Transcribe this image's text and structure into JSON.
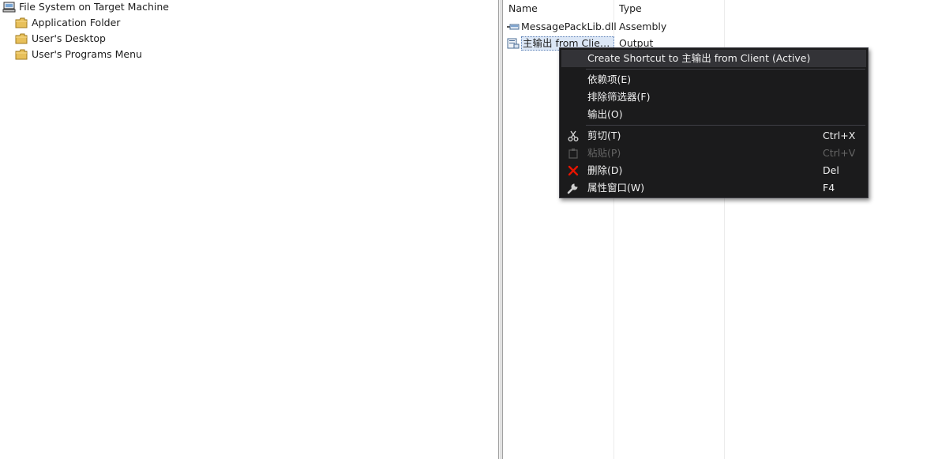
{
  "tree": {
    "root": {
      "label": "File System on Target Machine",
      "icon": "computer-icon"
    },
    "children": [
      {
        "label": "Application Folder",
        "icon": "folder-icon"
      },
      {
        "label": "User's Desktop",
        "icon": "folder-icon"
      },
      {
        "label": "User's Programs Menu",
        "icon": "folder-icon"
      }
    ]
  },
  "list": {
    "columns": {
      "name": "Name",
      "type": "Type"
    },
    "rows": [
      {
        "name": "MessagePackLib.dll",
        "type": "Assembly",
        "icon": "assembly-icon",
        "selected": false
      },
      {
        "name": "主输出 from Client...",
        "type": "Output",
        "icon": "project-output-icon",
        "selected": true
      }
    ]
  },
  "context_menu": {
    "items": [
      {
        "label": "Create Shortcut to 主输出 from Client (Active)",
        "shortcut": "",
        "icon": "",
        "enabled": true,
        "highlighted": true
      },
      {
        "label": "依赖项(E)",
        "shortcut": "",
        "icon": "",
        "enabled": true
      },
      {
        "label": "排除筛选器(F)",
        "shortcut": "",
        "icon": "",
        "enabled": true
      },
      {
        "label": "输出(O)",
        "shortcut": "",
        "icon": "",
        "enabled": true
      },
      {
        "label": "剪切(T)",
        "shortcut": "Ctrl+X",
        "icon": "scissors-icon",
        "enabled": true
      },
      {
        "label": "粘贴(P)",
        "shortcut": "Ctrl+V",
        "icon": "clipboard-icon",
        "enabled": false
      },
      {
        "label": "删除(D)",
        "shortcut": "Del",
        "icon": "delete-icon",
        "enabled": true
      },
      {
        "label": "属性窗口(W)",
        "shortcut": "F4",
        "icon": "wrench-icon",
        "enabled": true
      }
    ]
  },
  "colors": {
    "menu_background": "#1b1b1c",
    "menu_highlight": "#333337",
    "delete_icon": "#e51400",
    "folder": "#e8c05a"
  }
}
